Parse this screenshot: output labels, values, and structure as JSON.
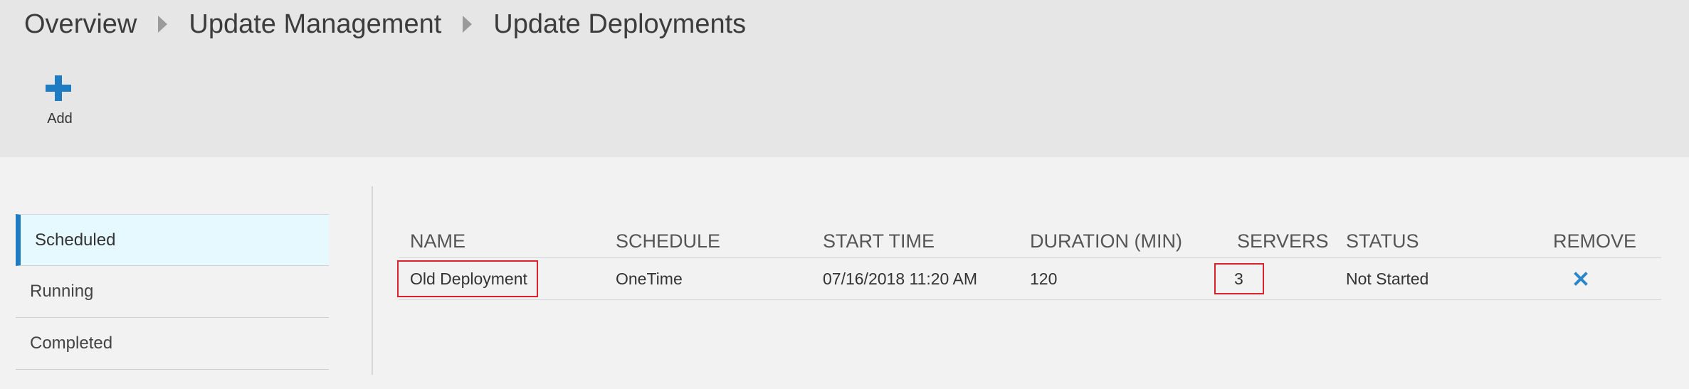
{
  "breadcrumb": [
    {
      "label": "Overview"
    },
    {
      "label": "Update Management"
    },
    {
      "label": "Update Deployments"
    }
  ],
  "toolbar": {
    "add_label": "Add",
    "add_icon": "plus-icon",
    "accent_color": "#1f7bc2"
  },
  "nav": {
    "items": [
      {
        "label": "Scheduled",
        "selected": true
      },
      {
        "label": "Running",
        "selected": false
      },
      {
        "label": "Completed",
        "selected": false
      }
    ]
  },
  "table": {
    "columns": [
      "NAME",
      "SCHEDULE",
      "START TIME",
      "DURATION (MIN)",
      "SERVERS",
      "STATUS",
      "REMOVE"
    ],
    "rows": [
      {
        "name": "Old Deployment",
        "schedule": "OneTime",
        "start_time": "07/16/2018 11:20 AM",
        "duration": "120",
        "servers": "3",
        "status": "Not Started",
        "remove_icon": "close-icon"
      }
    ]
  },
  "colors": {
    "highlight_outline": "#d9232d",
    "selected_nav_bg": "#e6f9ff",
    "remove_icon": "#2a86c9"
  }
}
